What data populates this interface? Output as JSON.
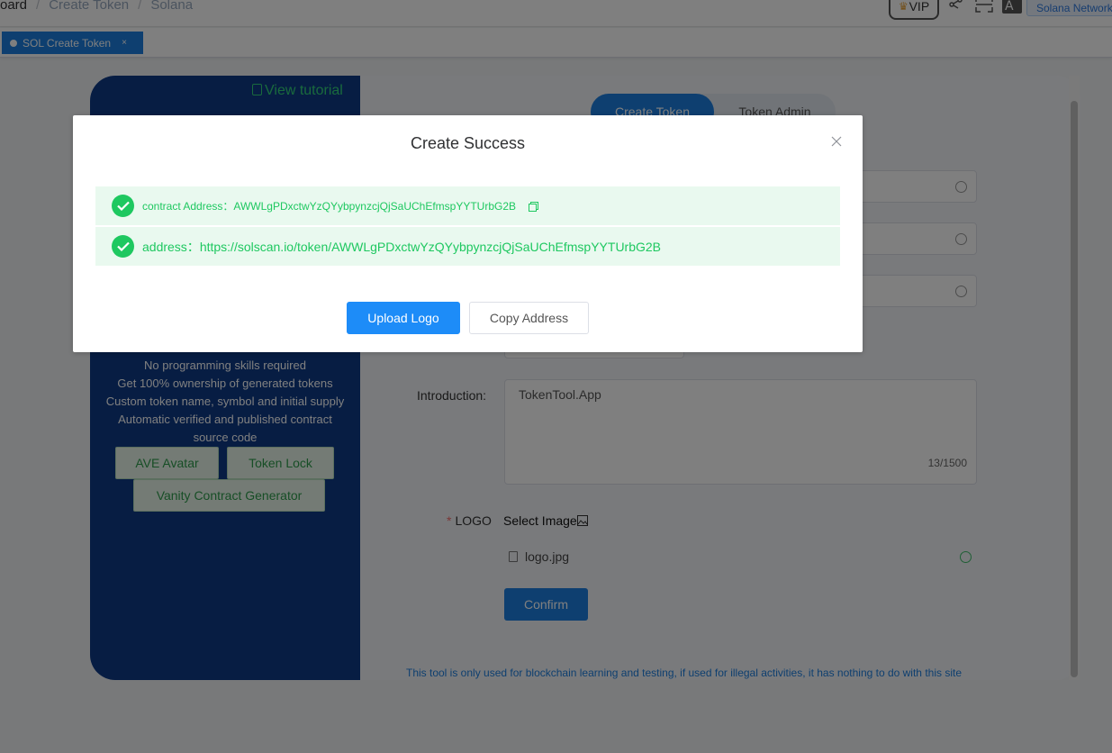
{
  "header": {
    "breadcrumbs": [
      "oard",
      "Create Token",
      "Solana"
    ],
    "vip_label": "VIP",
    "network_label": "Solana Network"
  },
  "tabs": [
    {
      "label": "SOL Create Token",
      "close": "×"
    }
  ],
  "left_panel": {
    "tutorial_label": "View tutorial",
    "features": [
      "No programming skills required",
      "Get 100% ownership of generated tokens",
      "Custom token name, symbol and initial supply",
      "Automatic verified and published contract",
      "source code"
    ],
    "buttons": {
      "ave_avatar": "AVE Avatar",
      "token_lock": "Token Lock",
      "vanity": "Vanity Contract Generator"
    }
  },
  "form": {
    "segments": {
      "create": "Create Token",
      "admin": "Token Admin"
    },
    "introduction_label": "Introduction:",
    "introduction_value": "TokenTool.App",
    "introduction_count": "13/1500",
    "logo_label": "LOGO",
    "logo_required": "*",
    "select_image": "Select Image",
    "file_name": "logo.jpg",
    "confirm_label": "Confirm",
    "disclaimer": "This tool is only used for blockchain learning and testing, if used for illegal activities, it has nothing to do with this site"
  },
  "modal": {
    "title": "Create Success",
    "contract_label": "contract Address：",
    "contract_value": "AWWLgPDxctwYzQYybpynzcjQjSaUChEfmspYYTUrbG2B",
    "address_label": "address：",
    "address_value": "https://solscan.io/token/AWWLgPDxctwYzQYybpynzcjQjSaUChEfmspYYTUrbG2B",
    "upload_logo": "Upload Logo",
    "copy_address": "Copy Address"
  },
  "colors": {
    "primary": "#1d8cf8",
    "success": "#1ec860",
    "sidebar": "#0e3a87"
  }
}
